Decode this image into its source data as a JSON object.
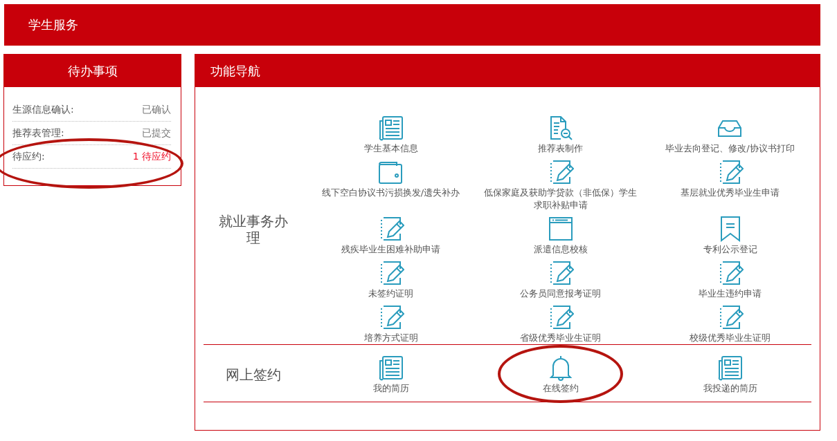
{
  "header": {
    "title": "学生服务"
  },
  "todo": {
    "title": "待办事项",
    "items": [
      {
        "label": "生源信息确认:",
        "value": "已确认",
        "urgent": false,
        "circled": false
      },
      {
        "label": "推荐表管理:",
        "value": "已提交",
        "urgent": false,
        "circled": false
      },
      {
        "label": "待应约:",
        "value": "1 待应约",
        "urgent": true,
        "circled": true
      }
    ]
  },
  "nav": {
    "title": "功能导航",
    "sections": [
      {
        "label": "就业事务办理",
        "items": [
          {
            "kind": "newspaper",
            "label": "学生基本信息",
            "circled": false
          },
          {
            "kind": "doc-search",
            "label": "推荐表制作",
            "circled": false
          },
          {
            "kind": "tray",
            "label": "毕业去向登记、修改/协议书打印",
            "circled": false
          },
          {
            "kind": "wallet",
            "label": "线下空白协议书污损换发/遗失补办",
            "circled": false
          },
          {
            "kind": "edit",
            "label": "低保家庭及获助学贷款（非低保）学生求职补贴申请",
            "circled": false
          },
          {
            "kind": "edit",
            "label": "基层就业优秀毕业生申请",
            "circled": false
          },
          {
            "kind": "edit",
            "label": "残疾毕业生困难补助申请",
            "circled": false
          },
          {
            "kind": "window",
            "label": "派遣信息校核",
            "circled": false
          },
          {
            "kind": "bookmark",
            "label": "专利公示登记",
            "circled": false
          },
          {
            "kind": "edit",
            "label": "未签约证明",
            "circled": false
          },
          {
            "kind": "edit",
            "label": "公务员同意报考证明",
            "circled": false
          },
          {
            "kind": "edit",
            "label": "毕业生违约申请",
            "circled": false
          },
          {
            "kind": "edit",
            "label": "培养方式证明",
            "circled": false
          },
          {
            "kind": "edit",
            "label": "省级优秀毕业生证明",
            "circled": false
          },
          {
            "kind": "edit",
            "label": "校级优秀毕业生证明",
            "circled": false
          }
        ]
      },
      {
        "label": "网上签约",
        "items": [
          {
            "kind": "newspaper",
            "label": "我的简历",
            "circled": false
          },
          {
            "kind": "bell",
            "label": "在线签约",
            "circled": true
          },
          {
            "kind": "newspaper",
            "label": "我投递的简历",
            "circled": false
          }
        ]
      }
    ]
  }
}
